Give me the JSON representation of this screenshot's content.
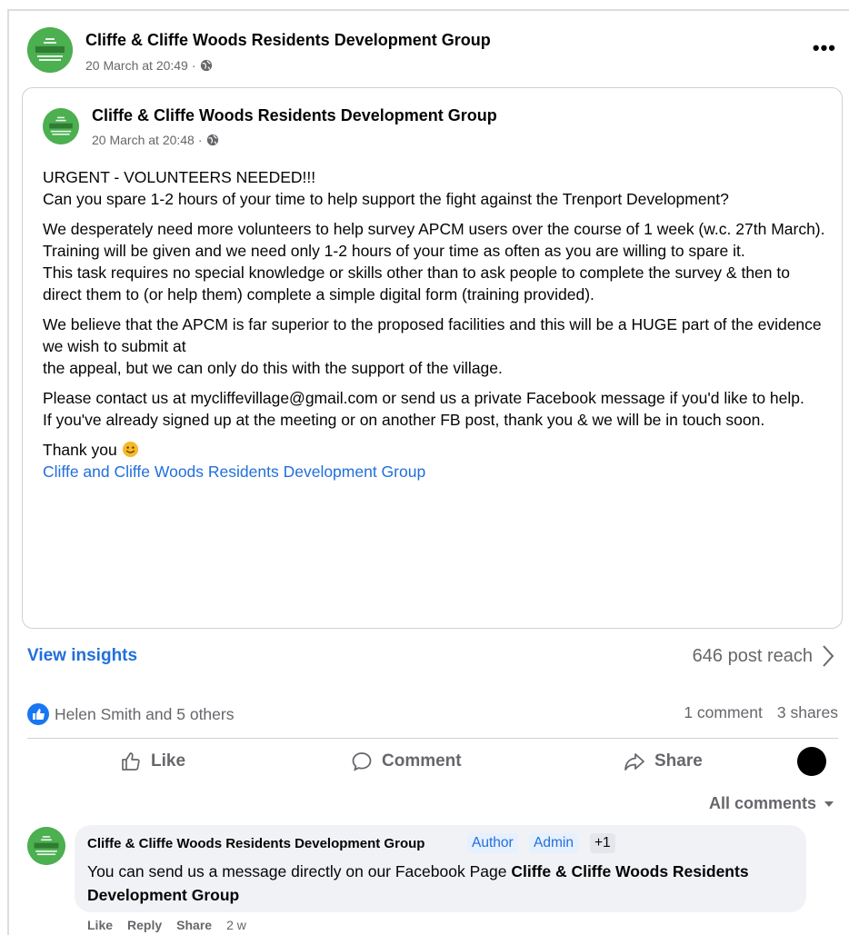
{
  "post": {
    "author": "Cliffe & Cliffe Woods Residents Development Group",
    "timestamp": "20 March at 20:49",
    "privacy_icon": "globe-icon",
    "more_icon": "•••"
  },
  "shared": {
    "author": "Cliffe & Cliffe Woods Residents Development Group",
    "timestamp": "20 March at 20:48",
    "privacy_icon": "globe-icon",
    "body": {
      "p1_l1": "URGENT - VOLUNTEERS NEEDED!!!",
      "p1_l2": "Can you spare 1-2 hours of your time to help support the fight against the Trenport Development?",
      "p2_l1": "We desperately need more volunteers to help survey APCM users over the course of 1 week (w.c. 27th March). Training will be given and we need only 1-2 hours of your time as often as you are willing to spare it.",
      "p2_l2": "This task requires no special knowledge or skills other than to ask people to complete the survey & then to direct them to (or help them) complete a simple digital form (training provided).",
      "p3_l1": "We believe that the APCM is far superior to the proposed facilities and this will be a HUGE part of the evidence we wish to submit at",
      "p3_l2": "the appeal, but we can only do this with the support of the village.",
      "p4_l1": "Please contact us at mycliffevillage@gmail.com or send us a private Facebook message if you'd like to help.",
      "p4_l2": "If you've already signed up at the meeting or on another FB post, thank you & we will be in touch soon.",
      "thanks": "Thank you",
      "signature": "Cliffe and Cliffe Woods Residents Development Group"
    }
  },
  "stats": {
    "view_insights": "View insights",
    "reach": "646 post reach",
    "reactors": "Helen Smith and 5 others",
    "comments": "1 comment",
    "shares": "3 shares"
  },
  "actions": {
    "like": "Like",
    "comment": "Comment",
    "share": "Share"
  },
  "comments_filter": "All comments",
  "comment": {
    "author": "Cliffe & Cliffe Woods Residents Development Group",
    "badge_author": "Author",
    "badge_admin": "Admin",
    "badge_more": "+1",
    "text_plain": "You can send us a message directly on our Facebook Page ",
    "text_bold": "Cliffe & Cliffe Woods Residents Development Group",
    "like": "Like",
    "reply": "Reply",
    "share": "Share",
    "time": "2 w"
  },
  "colors": {
    "accent": "#216fdb",
    "secondary_text": "#65676b",
    "avatar_green": "#4caf50"
  }
}
